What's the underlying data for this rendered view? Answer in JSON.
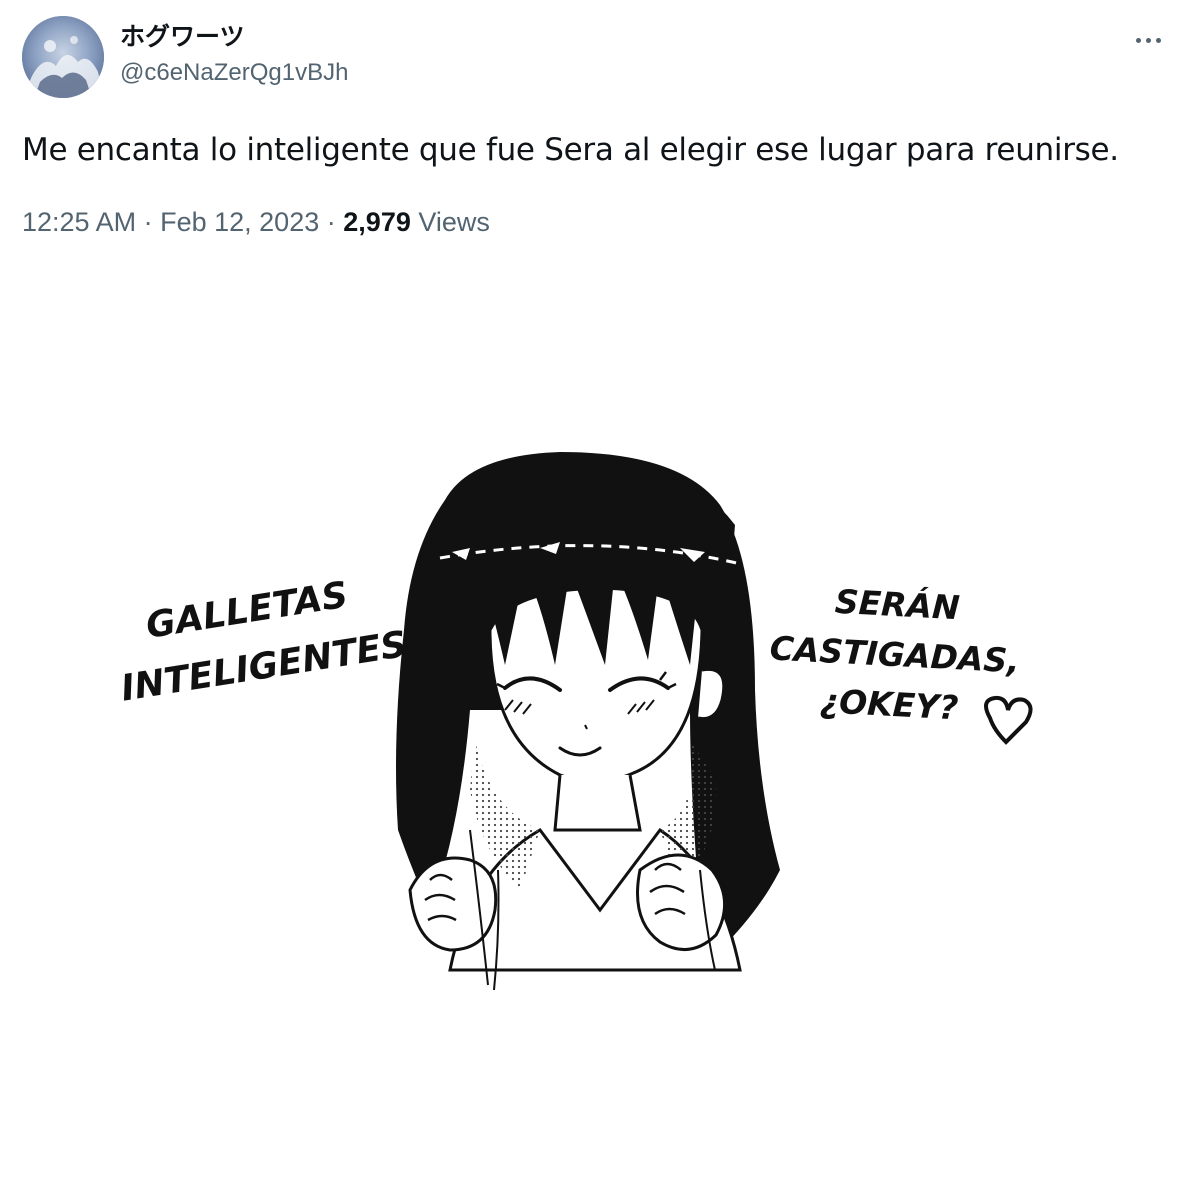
{
  "tweet": {
    "display_name": "ホグワーツ",
    "handle": "@c6eNaZerQg1vBJh",
    "more_icon": "more-horizontal-icon",
    "text": "Me encanta lo inteligente que fue Sera al elegir ese lugar para reunirse.",
    "time": "12:25 AM",
    "date": "Feb 12, 2023",
    "separator": "·",
    "views_count": "2,979",
    "views_label": "Views"
  },
  "media": {
    "left_caption": [
      "GALLETAS",
      "INTELIGENTES"
    ],
    "right_caption": [
      "SERÁN",
      "CASTIGADAS,",
      "¿OKEY?"
    ]
  },
  "colors": {
    "text_primary": "#0f1419",
    "text_secondary": "#536471",
    "background": "#ffffff"
  }
}
